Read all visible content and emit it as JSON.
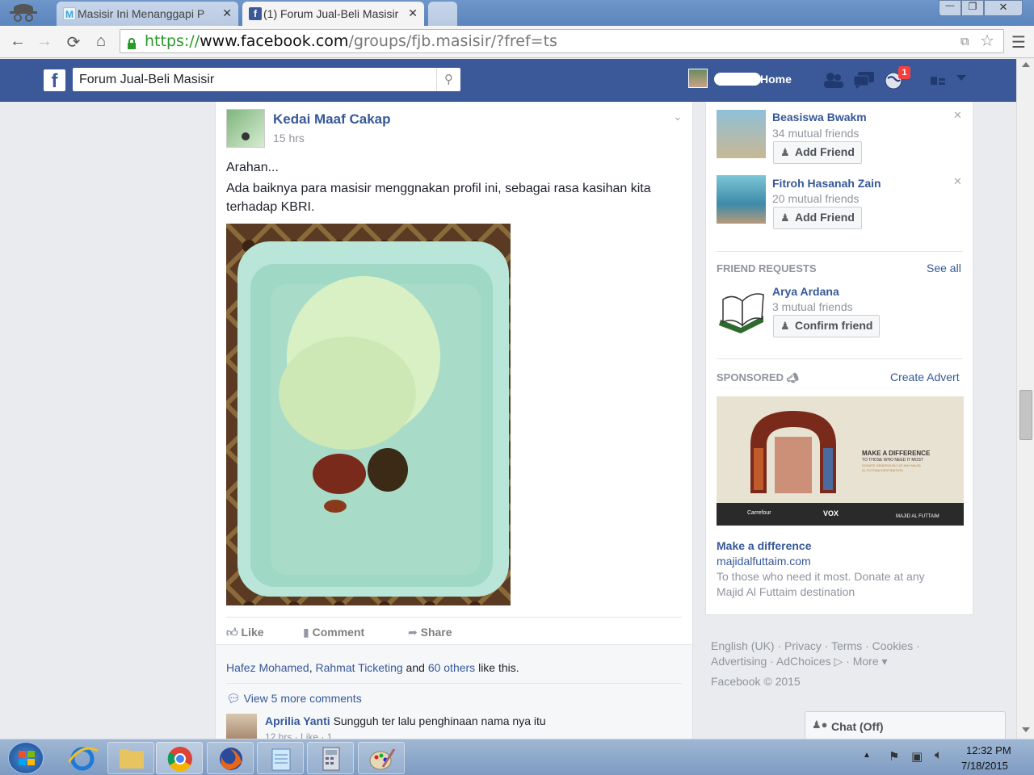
{
  "browser": {
    "tabs": [
      {
        "title": "Masisir Ini Menanggapi P",
        "icon": "M"
      },
      {
        "title": "(1) Forum Jual-Beli Masisir",
        "icon": "f"
      }
    ],
    "url_scheme": "https://",
    "url_host": "www.facebook.com",
    "url_path": "/groups/fjb.masisir/?fref=ts",
    "window_controls": {
      "min": "—",
      "max": "❐",
      "close": "✕"
    }
  },
  "fb": {
    "search_value": "Forum Jual-Beli Masisir",
    "home_label": "Home",
    "notif_count": "1"
  },
  "post": {
    "author": "Kedai Maaf Cakap",
    "time": "15 hrs",
    "text_line1": "Arahan...",
    "text_line2": "Ada baiknya para masisir menggnakan profil ini, sebagai rasa kasihan kita terhadap KBRI.",
    "actions": {
      "like": "Like",
      "comment": "Comment",
      "share": "Share"
    },
    "likers_1": "Hafez Mohamed",
    "likers_sep": ", ",
    "likers_2": "Rahmat Ticketing",
    "likers_and": " and ",
    "likers_others": "60 others",
    "likers_tail": " like this.",
    "view_more": "View 5 more comments",
    "comment_author": "Aprilia Yanti",
    "comment_text": "Sungguh ter lalu penghinaan nama nya itu",
    "comment_meta": "12 hrs · Like · 1"
  },
  "sidebar": {
    "suggestions": [
      {
        "name": "Beasiswa Bwakm",
        "mutual": "34 mutual friends",
        "button": "Add Friend"
      },
      {
        "name": "Fitroh Hasanah Zain",
        "mutual": "20 mutual friends",
        "button": "Add Friend"
      }
    ],
    "requests_header": "FRIEND REQUESTS",
    "see_all": "See all",
    "request": {
      "name": "Arya Ardana",
      "mutual": "3 mutual friends",
      "button": "Confirm friend"
    },
    "sponsored_header": "SPONSORED",
    "create_advert": "Create Advert",
    "ad": {
      "banner_text1": "MAKE A DIFFERENCE",
      "banner_text2": "TO THOSE WHO NEED IT MOST",
      "banner_text3": "DONATE GENEROUSLY AT ANY MAJID AL FUTTAIM DESTINATION",
      "logos": [
        "Carrefour",
        "VOX",
        "MAJID AL FUTTAIM"
      ],
      "title": "Make a difference",
      "domain": "majidalfuttaim.com",
      "desc": "To those who need it most. Donate at any Majid Al Futtaim destination"
    }
  },
  "footer": {
    "links1": "English (UK) · Privacy · Terms · Cookies ·",
    "links2": "Advertising · AdChoices ▷ · More ▾",
    "copyright": "Facebook © 2015"
  },
  "chat": {
    "label": "Chat (Off)"
  },
  "taskbar": {
    "time": "12:32 PM",
    "date": "7/18/2015"
  }
}
